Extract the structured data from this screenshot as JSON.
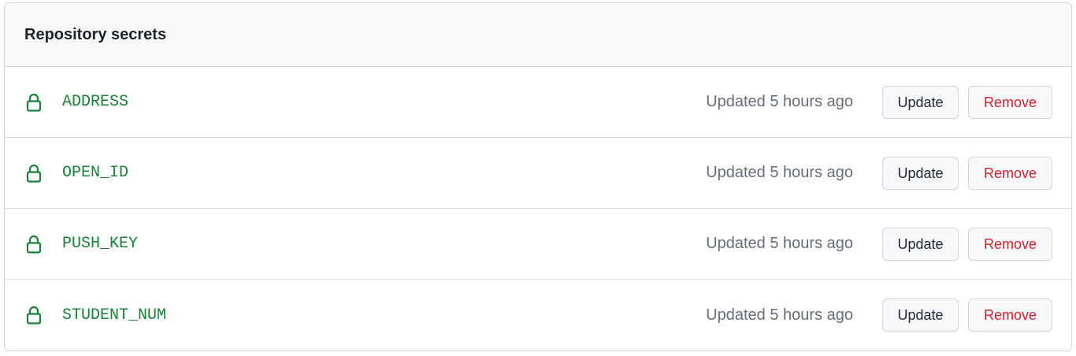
{
  "header": {
    "title": "Repository secrets"
  },
  "colors": {
    "secret_name": "#1a7f37",
    "updated_text": "#656d76",
    "remove_text": "#cf222e",
    "header_bg": "#f6f8fa",
    "border": "#d0d7de"
  },
  "secrets": [
    {
      "name": "ADDRESS",
      "updated": "Updated 5 hours ago",
      "update_label": "Update",
      "remove_label": "Remove",
      "icon": "lock-icon"
    },
    {
      "name": "OPEN_ID",
      "updated": "Updated 5 hours ago",
      "update_label": "Update",
      "remove_label": "Remove",
      "icon": "lock-icon"
    },
    {
      "name": "PUSH_KEY",
      "updated": "Updated 5 hours ago",
      "update_label": "Update",
      "remove_label": "Remove",
      "icon": "lock-icon"
    },
    {
      "name": "STUDENT_NUM",
      "updated": "Updated 5 hours ago",
      "update_label": "Update",
      "remove_label": "Remove",
      "icon": "lock-icon"
    }
  ]
}
